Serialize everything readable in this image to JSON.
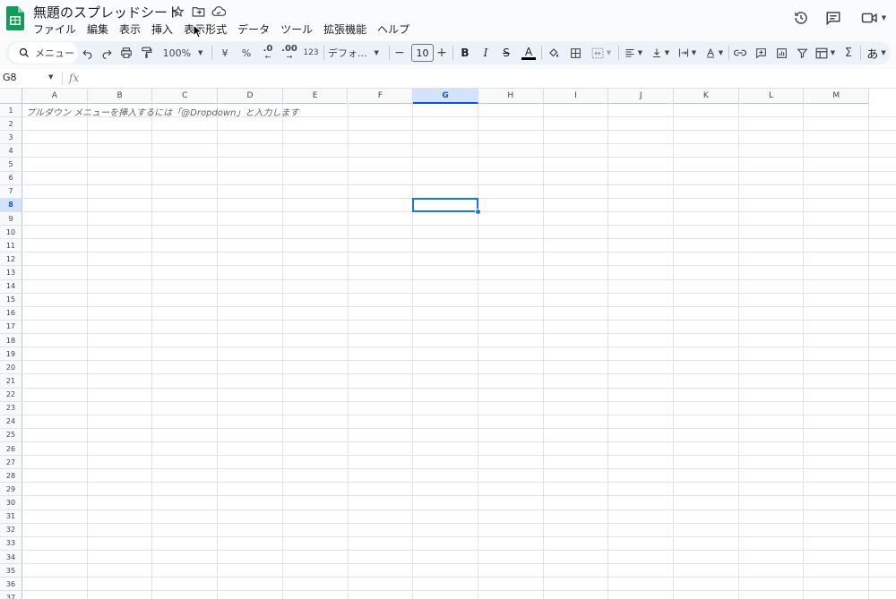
{
  "document": {
    "title": "無題のスプレッドシート"
  },
  "menu": [
    "ファイル",
    "編集",
    "表示",
    "挿入",
    "表示形式",
    "データ",
    "ツール",
    "拡張機能",
    "ヘルプ"
  ],
  "toolbar": {
    "search_label": "メニュー",
    "zoom": "100%",
    "currency": "¥",
    "percent": "%",
    "decrease_decimal": ".0",
    "increase_decimal": ".00",
    "number_format": "123",
    "font_family": "デフォ...",
    "font_size": "10",
    "input_tools": "あ"
  },
  "formula_bar": {
    "cell_ref": "G8",
    "fx": "fx",
    "value": ""
  },
  "columns": [
    "A",
    "B",
    "C",
    "D",
    "E",
    "F",
    "G",
    "H",
    "I",
    "J",
    "K",
    "L",
    "M"
  ],
  "active_column": "G",
  "rows": [
    "1",
    "2",
    "3",
    "4",
    "5",
    "6",
    "7",
    "8",
    "9",
    "10",
    "11",
    "12",
    "13",
    "14",
    "15",
    "16",
    "17",
    "18",
    "19",
    "20",
    "21",
    "22",
    "23",
    "24",
    "25",
    "26",
    "27",
    "28",
    "29",
    "30",
    "31",
    "32",
    "33",
    "34",
    "35",
    "36",
    "37"
  ],
  "active_row": "8",
  "cells": {
    "A1_hint": "プルダウン メニューを挿入するには「@Dropdown」と入力します"
  },
  "colors": {
    "accent": "#1a73e8",
    "header_active": "#d3e3fd",
    "sheets_green": "#0f9d58"
  }
}
